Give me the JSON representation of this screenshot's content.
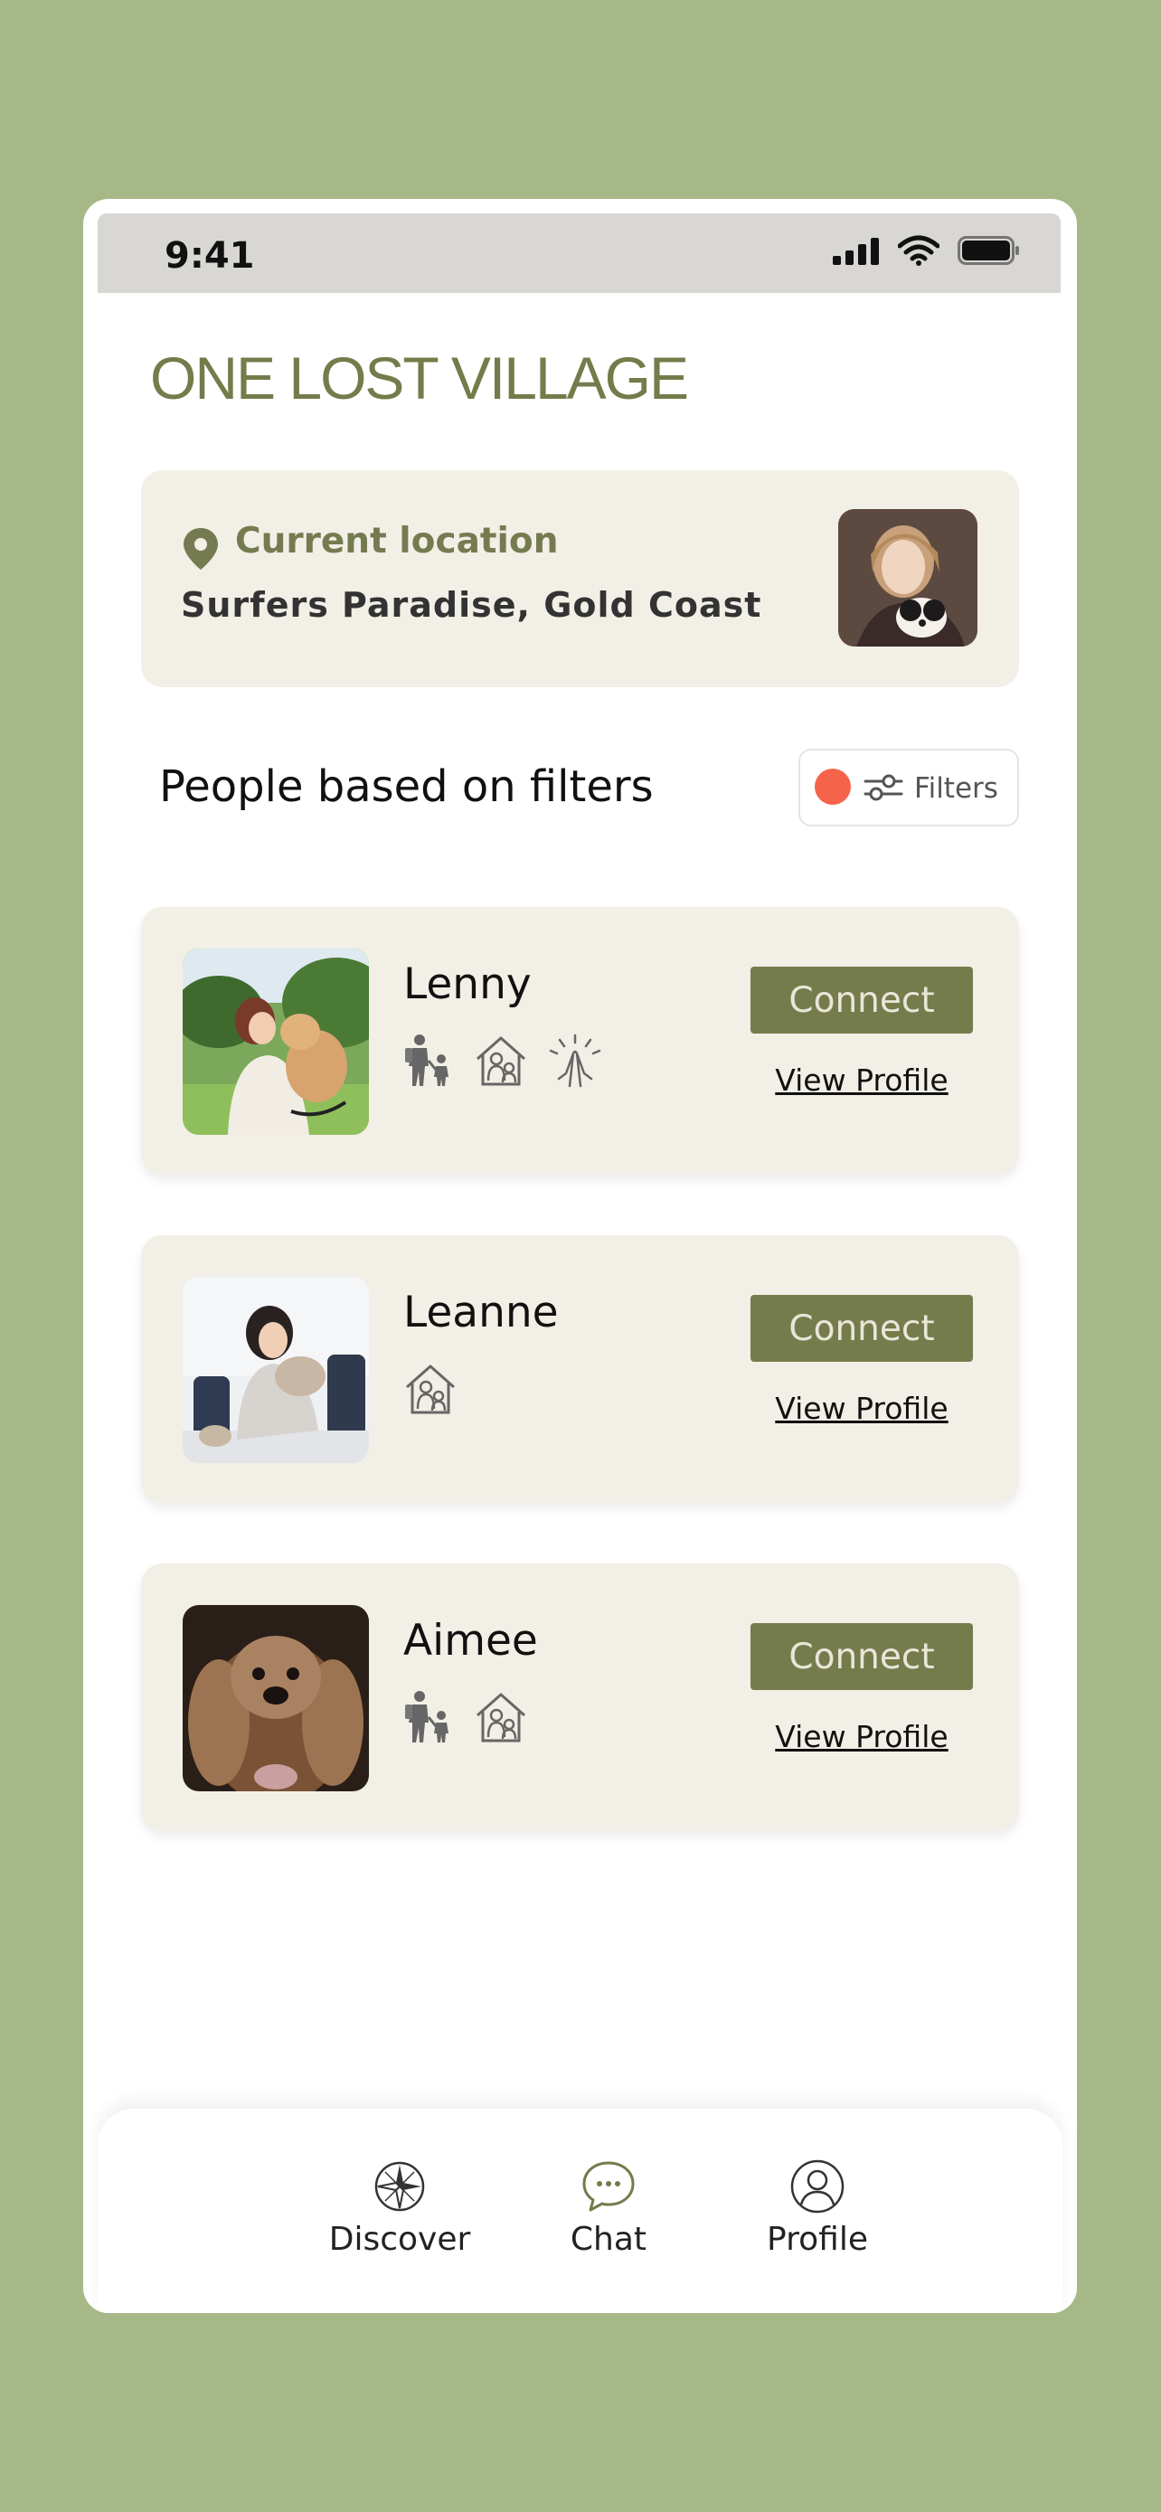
{
  "status_bar": {
    "time": "9:41",
    "icons": [
      "cellular-signal-icon",
      "wifi-icon",
      "battery-icon"
    ]
  },
  "app": {
    "title": "ONE LOST VILLAGE",
    "brand_color": "#737c4a",
    "background_color": "#a7b888"
  },
  "location": {
    "label": "Current location",
    "value": "Surfers Paradise, Gold Coast",
    "icon": "map-pin-icon"
  },
  "people_section": {
    "title": "People based on filters",
    "filters_label": "Filters",
    "filter_indicator_color": "#f5644a"
  },
  "people": [
    {
      "name": "Lenny",
      "connect_label": "Connect",
      "view_profile_label": "View Profile",
      "traits": [
        "parent-child-icon",
        "home-family-icon",
        "high-five-icon"
      ]
    },
    {
      "name": "Leanne",
      "connect_label": "Connect",
      "view_profile_label": "View Profile",
      "traits": [
        "home-family-icon"
      ]
    },
    {
      "name": "Aimee",
      "connect_label": "Connect",
      "view_profile_label": "View Profile",
      "traits": [
        "parent-child-icon",
        "home-family-icon"
      ]
    }
  ],
  "nav": {
    "items": [
      {
        "label": "Discover",
        "icon": "compass-icon"
      },
      {
        "label": "Chat",
        "icon": "chat-bubble-icon"
      },
      {
        "label": "Profile",
        "icon": "user-profile-icon"
      }
    ]
  }
}
